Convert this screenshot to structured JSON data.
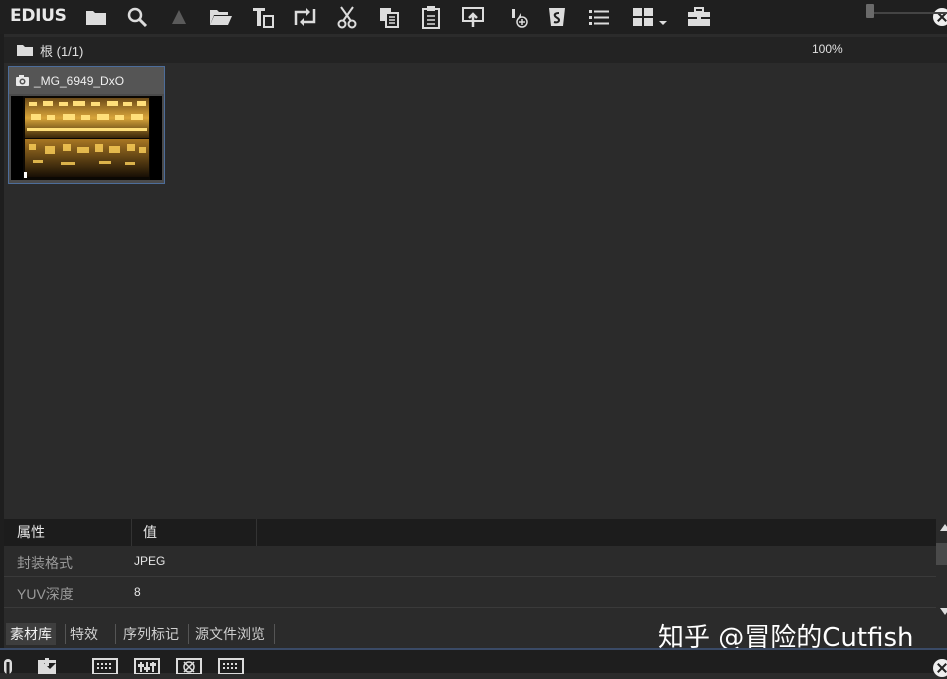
{
  "app": {
    "brand": "EDIUS"
  },
  "toolbar": {
    "icons": [
      "folder-icon",
      "search-icon",
      "up-arrow-icon",
      "open-folder-icon",
      "title-icon",
      "replace-icon",
      "cut-icon",
      "copy-icon",
      "paste-icon",
      "add-to-timeline-icon",
      "add-clip-icon",
      "sequence-icon",
      "list-view-icon",
      "thumbnail-view-icon",
      "toolbox-icon"
    ]
  },
  "path": {
    "label": "根 (1/1)",
    "zoom": "100%",
    "zoom_level": 0.0
  },
  "clip": {
    "name": "_MG_6949_DxO"
  },
  "properties": {
    "headers": [
      "属性",
      "值"
    ],
    "rows": [
      {
        "key": "封装格式",
        "value": "JPEG"
      },
      {
        "key": "YUV深度",
        "value": "8"
      }
    ]
  },
  "tabs": [
    "素材库",
    "特效",
    "序列标记",
    "源文件浏览"
  ],
  "watermark": "知乎 @冒险的Cutfish",
  "colors": {
    "background": "#2b2b2b",
    "toolbar": "#1f1f1f",
    "selection": "#4d6d9a"
  }
}
